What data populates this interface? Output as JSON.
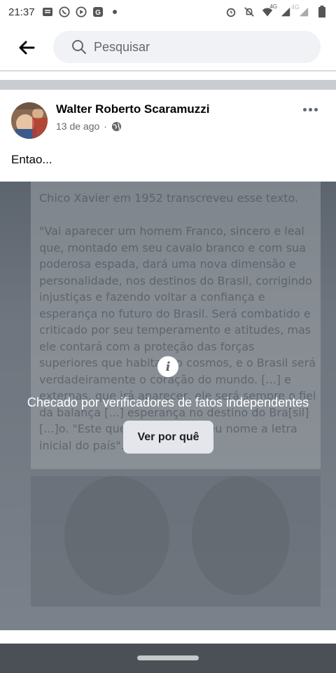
{
  "status_bar": {
    "time": "21:37",
    "left_icons": [
      "message-icon",
      "whatsapp-icon",
      "youtube-icon",
      "news-icon",
      "dot-icon"
    ],
    "right_icons": [
      "alarm-icon",
      "mute-icon",
      "wifi-icon",
      "signal-icon",
      "signal-icon",
      "battery-icon"
    ],
    "network_label_1": "4G",
    "network_label_2": "4G"
  },
  "search": {
    "placeholder": "Pesquisar"
  },
  "post": {
    "author": "Walter Roberto Scaramuzzi",
    "time": "13 de ago",
    "separator": "·",
    "text": "Entao...",
    "doc_text": "Chico Xavier em 1952 transcreveu esse texto.\n\n\"Vai aparecer um homem Franco, sincero e leal que, montado em seu cavalo branco e com sua poderosa espada, dará uma nova dimensão e personalidade, nos destinos do Brasil, corrigindo injustiças e fazendo voltar a confiança e esperança no futuro do Brasil. Será combatido e criticado por seu temperamento e atitudes, mas ele contará com a proteção das forças superiores que habitam o cosmos, e o Brasil será verdadeiramente o coração do mundo. [...] e externas, que irá aparecer, ele será sempre o fiel da balança [...] esperança no destino do Bra[sil] [...]o. \"Este que surgirá, terá seu nome a letra inicial do país\".",
    "fact_check_label": "Checado por verificadores de fatos independentes",
    "see_why_label": "Ver por quê",
    "info_glyph": "i"
  },
  "colors": {
    "accent": "#1877f2",
    "card_bg": "#ffffff",
    "separator": "#c9ccd1"
  }
}
